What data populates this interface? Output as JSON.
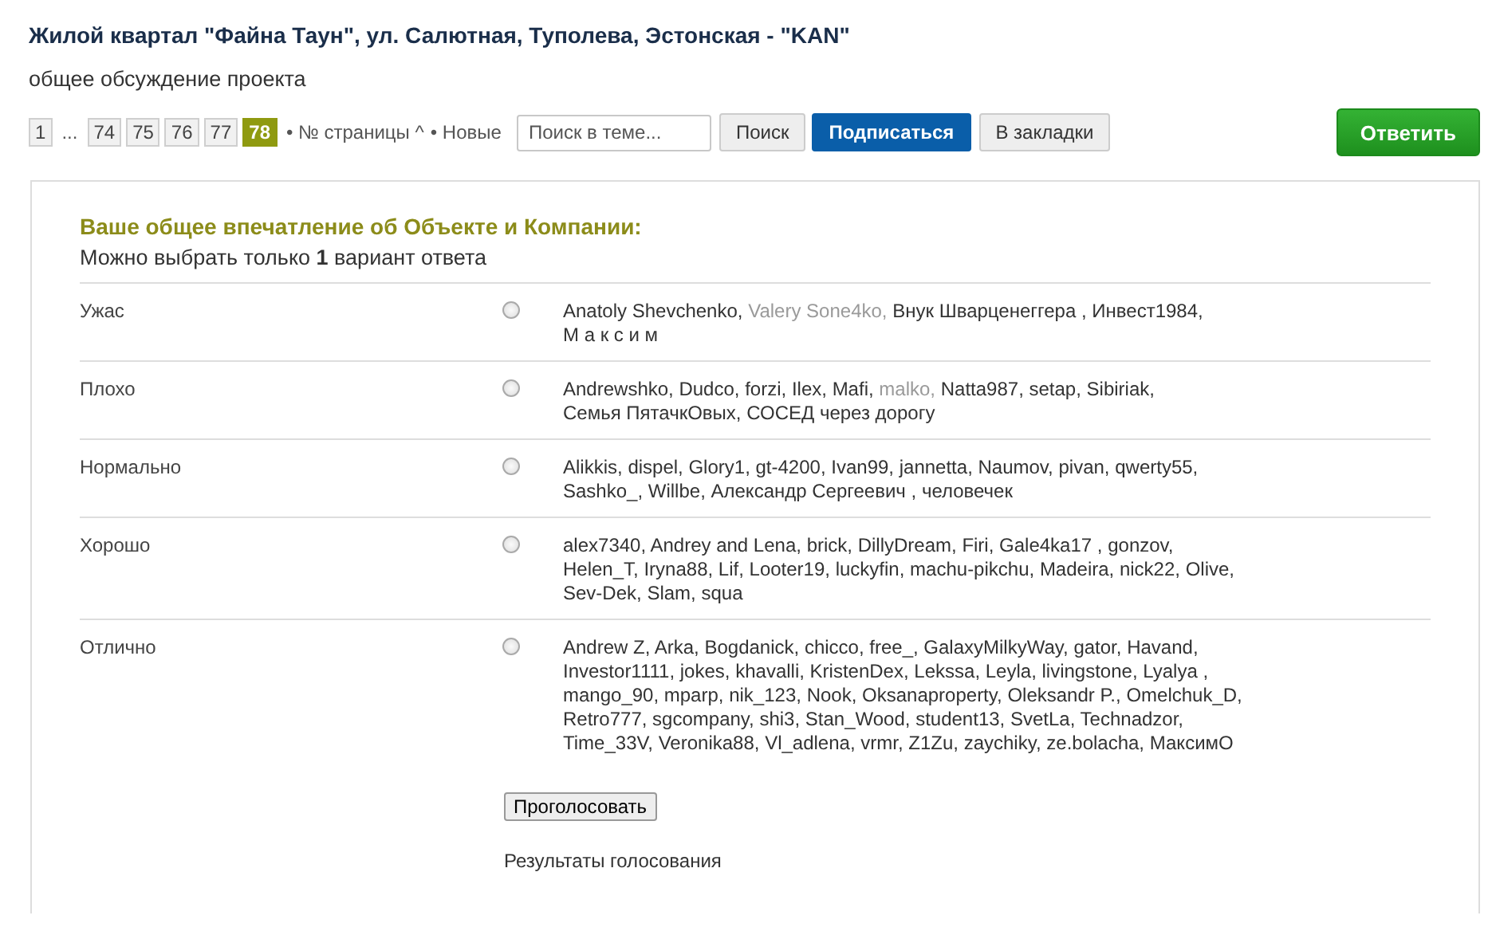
{
  "topic": {
    "title": "Жилой квартал \"Файна Таун\", ул. Салютная, Туполева, Эстонская - \"KAN\"",
    "subtitle": "общее обсуждение проекта"
  },
  "pager": {
    "pages": [
      {
        "label": "1",
        "selected": false
      },
      {
        "label": "...",
        "kind": "gap"
      },
      {
        "label": "74",
        "selected": false
      },
      {
        "label": "75",
        "selected": false
      },
      {
        "label": "76",
        "selected": false
      },
      {
        "label": "77",
        "selected": false
      },
      {
        "label": "78",
        "selected": true
      }
    ],
    "links": [
      "• № страницы ^",
      "• Новые"
    ]
  },
  "search": {
    "placeholder": "Поиск в теме...",
    "button": "Поиск"
  },
  "buttons": {
    "subscribe": "Подписаться",
    "bookmark": "В закладки",
    "reply": "Ответить"
  },
  "poll": {
    "question": "Ваше общее впечатление об Объекте и Компании:",
    "hint": "Можно выбрать только **1** вариант ответа",
    "options": [
      {
        "label": "Ужас",
        "selected": false,
        "voters": [
          {
            "name": "Anatoly Shevchenko,",
            "dimmed": false
          },
          {
            "name": "Valery Sone4ko,",
            "dimmed": true
          },
          {
            "name": "Внук Шварценеггера ,",
            "dimmed": false
          },
          {
            "name": "Инвест1984,",
            "dimmed": false
          },
          {
            "name": "М а к с и м",
            "dimmed": false
          }
        ]
      },
      {
        "label": "Плохо",
        "selected": false,
        "voters": [
          {
            "name": "Andrewshko,",
            "dimmed": false
          },
          {
            "name": "Dudco,",
            "dimmed": false
          },
          {
            "name": "forzi,",
            "dimmed": false
          },
          {
            "name": "Ilex,",
            "dimmed": false
          },
          {
            "name": "Mafi,",
            "dimmed": false
          },
          {
            "name": "malko,",
            "dimmed": true
          },
          {
            "name": "Natta987,",
            "dimmed": false
          },
          {
            "name": "setap,",
            "dimmed": false
          },
          {
            "name": "Sibiriak,",
            "dimmed": false
          },
          {
            "name": "Семья ПятачкОвых,",
            "dimmed": false
          },
          {
            "name": "СОСЕД через дорогу",
            "dimmed": false
          }
        ]
      },
      {
        "label": "Нормально",
        "selected": false,
        "voters": [
          {
            "name": "Alikkis,",
            "dimmed": false
          },
          {
            "name": "dispel,",
            "dimmed": false
          },
          {
            "name": "Glory1,",
            "dimmed": false
          },
          {
            "name": "gt-4200,",
            "dimmed": false
          },
          {
            "name": "Ivan99,",
            "dimmed": false
          },
          {
            "name": "jannetta,",
            "dimmed": false
          },
          {
            "name": "Naumov,",
            "dimmed": false
          },
          {
            "name": "pivan,",
            "dimmed": false
          },
          {
            "name": "qwerty55,",
            "dimmed": false
          },
          {
            "name": "Sashko_,",
            "dimmed": false
          },
          {
            "name": "Willbe,",
            "dimmed": false
          },
          {
            "name": "Александр Сергеевич ,",
            "dimmed": false
          },
          {
            "name": "человечек",
            "dimmed": false
          }
        ]
      },
      {
        "label": "Хорошо",
        "selected": false,
        "voters": [
          {
            "name": "alex7340,",
            "dimmed": false
          },
          {
            "name": "Andrey and Lena,",
            "dimmed": false
          },
          {
            "name": "brick,",
            "dimmed": false
          },
          {
            "name": "DillyDream,",
            "dimmed": false
          },
          {
            "name": "Firi,",
            "dimmed": false
          },
          {
            "name": "Gale4ka17 ,",
            "dimmed": false
          },
          {
            "name": "gonzov,",
            "dimmed": false
          },
          {
            "name": "Helen_T,",
            "dimmed": false
          },
          {
            "name": "Iryna88,",
            "dimmed": false
          },
          {
            "name": "Lif,",
            "dimmed": false
          },
          {
            "name": "Looter19,",
            "dimmed": false
          },
          {
            "name": "luckyfin,",
            "dimmed": false
          },
          {
            "name": "machu-pikchu,",
            "dimmed": false
          },
          {
            "name": "Madeira,",
            "dimmed": false
          },
          {
            "name": "nick22,",
            "dimmed": false
          },
          {
            "name": "Olive,",
            "dimmed": false
          },
          {
            "name": "Sev-Dek,",
            "dimmed": false
          },
          {
            "name": "Slam,",
            "dimmed": false
          },
          {
            "name": "squa",
            "dimmed": false
          }
        ]
      },
      {
        "label": "Отлично",
        "selected": false,
        "voters": [
          {
            "name": "Andrew Z,",
            "dimmed": false
          },
          {
            "name": "Arka,",
            "dimmed": false
          },
          {
            "name": "Bogdanick,",
            "dimmed": false
          },
          {
            "name": "chicco,",
            "dimmed": false
          },
          {
            "name": "free_,",
            "dimmed": false
          },
          {
            "name": "GalaxyMilkyWay,",
            "dimmed": false
          },
          {
            "name": "gator,",
            "dimmed": false
          },
          {
            "name": "Havand,",
            "dimmed": false
          },
          {
            "name": "Investor1111,",
            "dimmed": false
          },
          {
            "name": "jokes,",
            "dimmed": false
          },
          {
            "name": "khavalli,",
            "dimmed": false
          },
          {
            "name": "KristenDex,",
            "dimmed": false
          },
          {
            "name": "Lekssa,",
            "dimmed": false
          },
          {
            "name": "Leyla,",
            "dimmed": false
          },
          {
            "name": "livingstone,",
            "dimmed": false
          },
          {
            "name": "Lyalya ,",
            "dimmed": false
          },
          {
            "name": "mango_90,",
            "dimmed": false
          },
          {
            "name": "mparp,",
            "dimmed": false
          },
          {
            "name": "nik_123,",
            "dimmed": false
          },
          {
            "name": "Nook,",
            "dimmed": false
          },
          {
            "name": "Oksanaproperty,",
            "dimmed": false
          },
          {
            "name": "Oleksandr P.,",
            "dimmed": false
          },
          {
            "name": "Omelchuk_D,",
            "dimmed": false
          },
          {
            "name": "Retro777,",
            "dimmed": false
          },
          {
            "name": "sgcompany,",
            "dimmed": false
          },
          {
            "name": "shi3,",
            "dimmed": false
          },
          {
            "name": "Stan_Wood,",
            "dimmed": false
          },
          {
            "name": "student13,",
            "dimmed": false
          },
          {
            "name": "SvetLa,",
            "dimmed": false
          },
          {
            "name": "Technadzor,",
            "dimmed": false
          },
          {
            "name": "Time_33V,",
            "dimmed": false
          },
          {
            "name": "Veronika88,",
            "dimmed": false
          },
          {
            "name": "Vl_adlena,",
            "dimmed": false
          },
          {
            "name": "vrmr,",
            "dimmed": false
          },
          {
            "name": "Z1Zu,",
            "dimmed": false
          },
          {
            "name": "zaychiky,",
            "dimmed": false
          },
          {
            "name": "ze.bolacha,",
            "dimmed": false
          },
          {
            "name": "МаксимО",
            "dimmed": false
          }
        ]
      }
    ],
    "vote_button": "Проголосовать",
    "results_link": "Результаты голосования"
  }
}
